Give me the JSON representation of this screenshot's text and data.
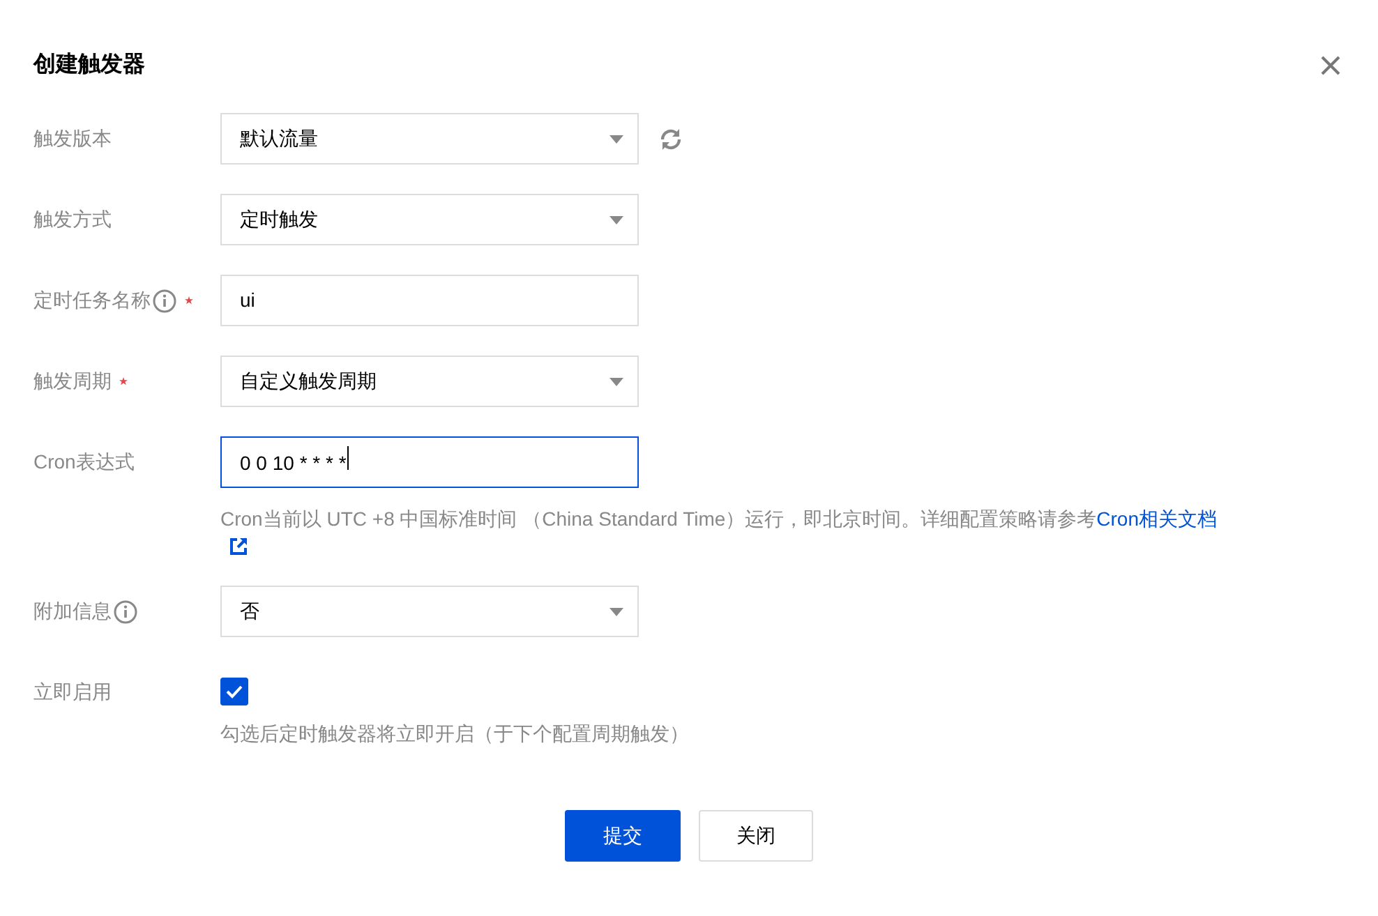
{
  "dialog": {
    "title": "创建触发器"
  },
  "fields": [
    {
      "kind": "select",
      "label": "触发版本",
      "value": "默认流量",
      "required": false,
      "info": false,
      "refresh": true,
      "focused": false
    },
    {
      "kind": "select",
      "label": "触发方式",
      "value": "定时触发",
      "required": false,
      "info": false,
      "refresh": false,
      "focused": false
    },
    {
      "kind": "input",
      "label": "定时任务名称",
      "value": "ui",
      "required": true,
      "info": true,
      "refresh": false,
      "focused": false
    },
    {
      "kind": "select",
      "label": "触发周期",
      "value": "自定义触发周期",
      "required": true,
      "info": false,
      "refresh": false,
      "focused": false
    },
    {
      "kind": "input",
      "label": "Cron表达式",
      "value": "0 0 10 * * * *",
      "required": false,
      "info": false,
      "refresh": false,
      "focused": true,
      "help": "Cron当前以 UTC +8 中国标准时间 （China Standard Time）运行，即北京时间。详细配置策略请参考",
      "help_link": "Cron相关文档"
    },
    {
      "kind": "select",
      "label": "附加信息",
      "value": "否",
      "required": false,
      "info": true,
      "refresh": false,
      "focused": false
    },
    {
      "kind": "checkbox",
      "label": "立即启用",
      "checked": true,
      "required": false,
      "info": false,
      "refresh": false,
      "focused": false,
      "help": "勾选后定时触发器将立即开启（于下个配置周期触发）"
    }
  ],
  "buttons": [
    {
      "label": "提交",
      "primary": true
    },
    {
      "label": "关闭",
      "primary": false
    }
  ]
}
